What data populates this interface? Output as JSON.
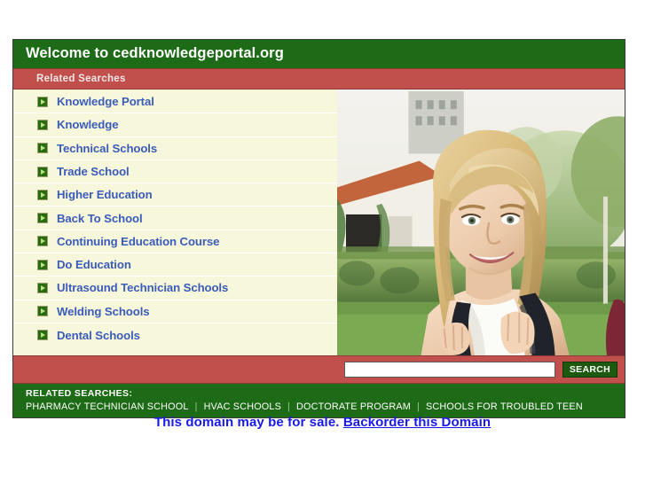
{
  "header": {
    "title": "Welcome to cedknowledgeportal.org",
    "subtitle": "Related Searches"
  },
  "colors": {
    "green": "#1d6b16",
    "red": "#c14f4c",
    "list_background": "#f7f7dc",
    "link_blue": "#3b5cb8",
    "sale_blue": "#1a1ae6"
  },
  "related_searches": [
    {
      "label": "Knowledge Portal"
    },
    {
      "label": "Knowledge"
    },
    {
      "label": "Technical Schools"
    },
    {
      "label": "Trade School"
    },
    {
      "label": "Higher Education"
    },
    {
      "label": "Back To School"
    },
    {
      "label": "Continuing Education Course"
    },
    {
      "label": "Do Education"
    },
    {
      "label": "Ultrasound Technician Schools"
    },
    {
      "label": "Welding Schools"
    },
    {
      "label": "Dental Schools"
    }
  ],
  "photo": {
    "alt": "Smiling blonde female student wearing a backpack in front of a campus building"
  },
  "search": {
    "value": "",
    "placeholder": "",
    "button_label": "SEARCH"
  },
  "footer": {
    "title": "RELATED SEARCHES:",
    "links": [
      {
        "label": "PHARMACY TECHNICIAN SCHOOL"
      },
      {
        "label": "HVAC SCHOOLS"
      },
      {
        "label": "DOCTORATE PROGRAM"
      },
      {
        "label": "SCHOOLS FOR TROUBLED TEEN"
      }
    ],
    "separator": "|"
  },
  "sale": {
    "text": "This domain may be for sale.",
    "link_label": "Backorder this Domain"
  }
}
